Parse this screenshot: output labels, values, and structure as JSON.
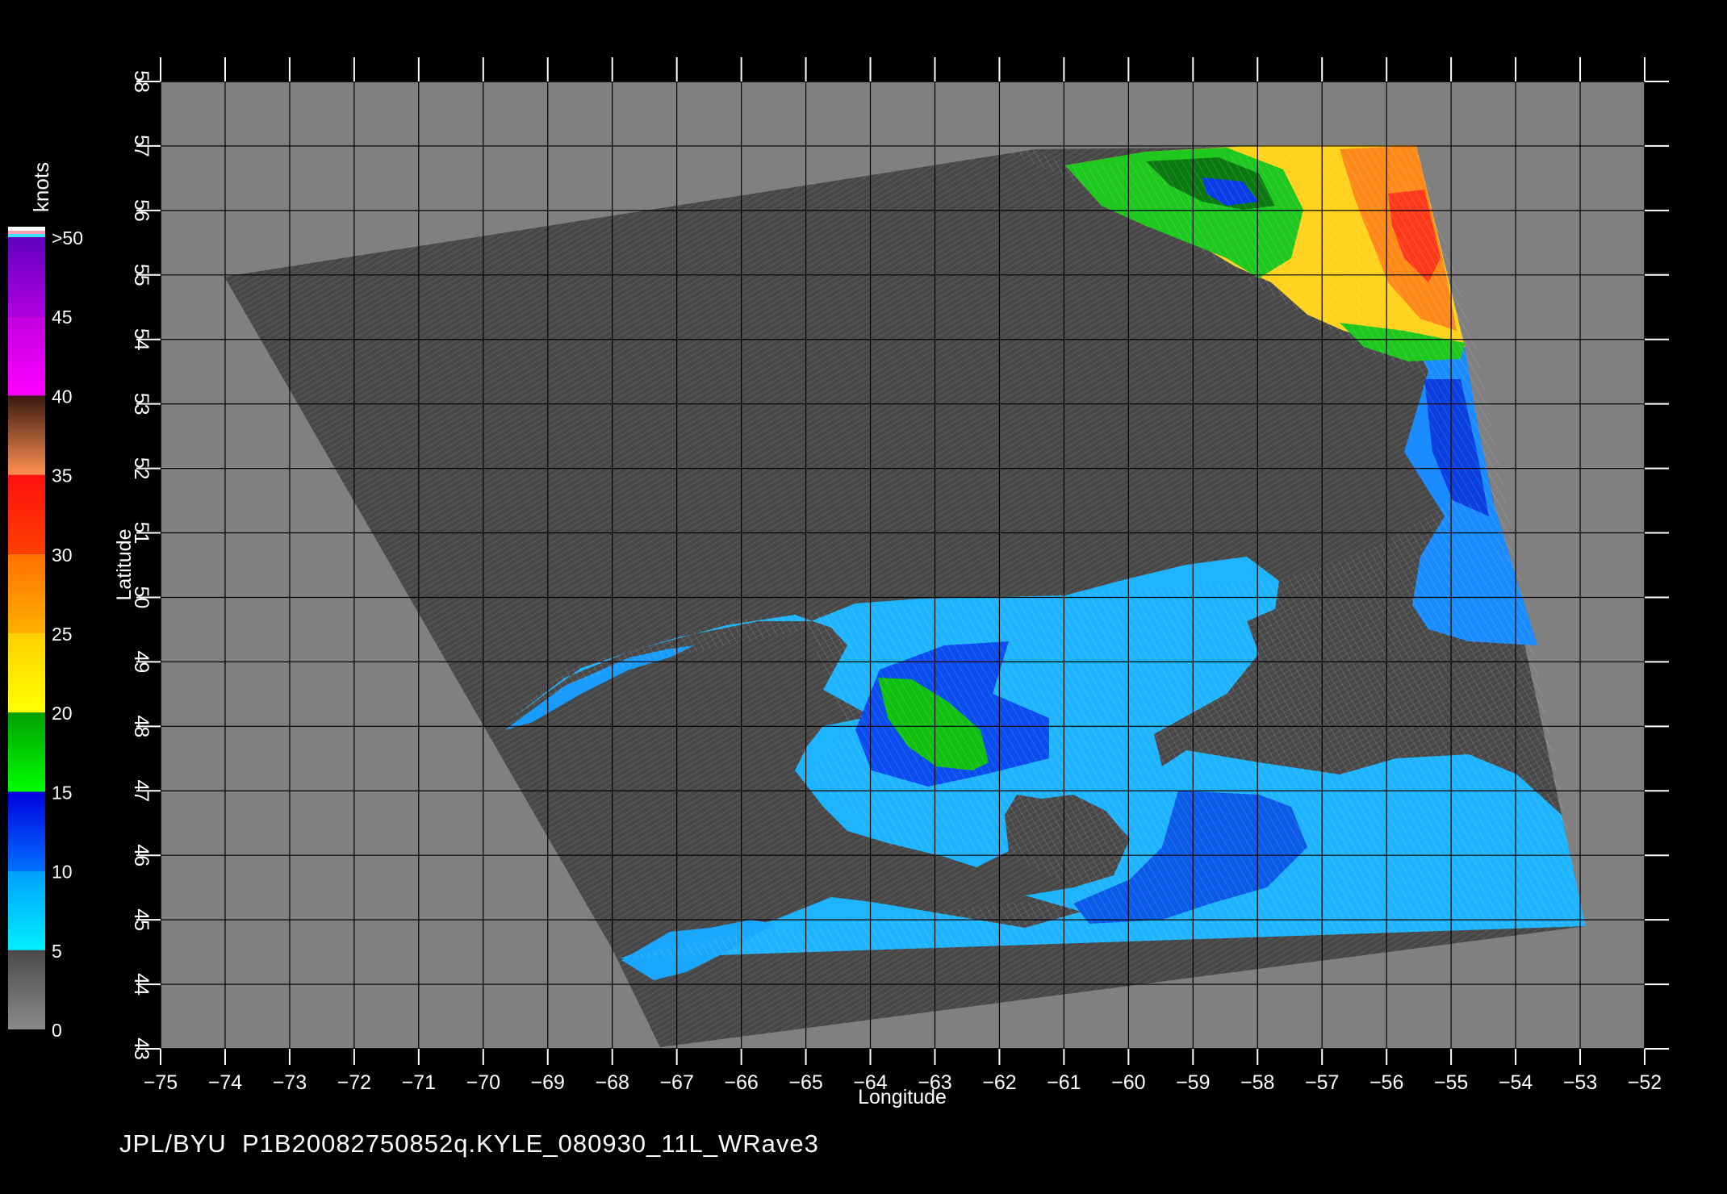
{
  "map": {
    "lon_ticks": [
      "-75",
      "-74",
      "-73",
      "-72",
      "-71",
      "-70",
      "-69",
      "-68",
      "-67",
      "-66",
      "-65",
      "-64",
      "-63",
      "-62",
      "-61",
      "-60",
      "-59",
      "-58",
      "-57",
      "-56",
      "-55",
      "-54",
      "-53",
      "-52"
    ],
    "lat_ticks": [
      "43",
      "44",
      "45",
      "46",
      "47",
      "48",
      "49",
      "50",
      "51",
      "52",
      "53",
      "54",
      "55",
      "56",
      "57",
      "58"
    ],
    "xlabel": "Longitude",
    "ylabel": "Latitude",
    "lon_range": [
      -75,
      -52
    ],
    "lat_range": [
      43,
      58
    ],
    "grid": true,
    "background_color": "#808080",
    "land_color": "#4a4a4a"
  },
  "colorbar": {
    "title": "knots",
    "labels": [
      "0",
      "5",
      "10",
      "15",
      "20",
      "25",
      "30",
      "35",
      "40",
      "45",
      ">50"
    ],
    "segments": [
      {
        "from": 0,
        "to": 5,
        "colors": [
          "#8a8a8a",
          "#4a4a4a"
        ]
      },
      {
        "from": 5,
        "to": 10,
        "colors": [
          "#00f0ff",
          "#00a0ff"
        ]
      },
      {
        "from": 10,
        "to": 15,
        "colors": [
          "#0070ff",
          "#0000e0"
        ]
      },
      {
        "from": 15,
        "to": 20,
        "colors": [
          "#00ff00",
          "#00a000"
        ]
      },
      {
        "from": 20,
        "to": 25,
        "colors": [
          "#ffff00",
          "#ffd000"
        ]
      },
      {
        "from": 25,
        "to": 30,
        "colors": [
          "#ffb000",
          "#ff7000"
        ]
      },
      {
        "from": 30,
        "to": 35,
        "colors": [
          "#ff4000",
          "#ff1010"
        ]
      },
      {
        "from": 35,
        "to": 40,
        "colors": [
          "#ff9050",
          "#3a1a10"
        ]
      },
      {
        "from": 40,
        "to": 45,
        "colors": [
          "#ff00ff",
          "#c000e0"
        ]
      },
      {
        "from": 45,
        "to": 50,
        "colors": [
          "#b000e0",
          "#6000c0"
        ]
      }
    ]
  },
  "footer": {
    "text": "JPL/BYU  P1B20082750852q.KYLE_080930_11L_WRave3"
  }
}
